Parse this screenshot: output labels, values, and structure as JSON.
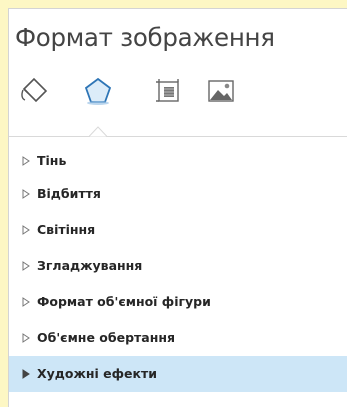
{
  "panel": {
    "title": "Формат зображення",
    "tabs": [
      {
        "icon": "paint-bucket-icon"
      },
      {
        "icon": "pentagon-shape-icon",
        "selected": true
      },
      {
        "icon": "layout-size-icon"
      },
      {
        "icon": "picture-icon"
      }
    ]
  },
  "sections": [
    {
      "label": "Тінь",
      "expanded": false
    },
    {
      "label": "Відбиття",
      "expanded": false
    },
    {
      "label": "Світіння",
      "expanded": false
    },
    {
      "label": "Згладжування",
      "expanded": false
    },
    {
      "label": "Формат об'ємної фігури",
      "expanded": false
    },
    {
      "label": "Об'ємне обертання",
      "expanded": false
    },
    {
      "label": "Художні ефекти",
      "expanded": false,
      "highlighted": true
    }
  ],
  "colors": {
    "background": "#fdf7c4",
    "highlight": "#cde6f7",
    "selected_icon": "#2e75b6"
  }
}
